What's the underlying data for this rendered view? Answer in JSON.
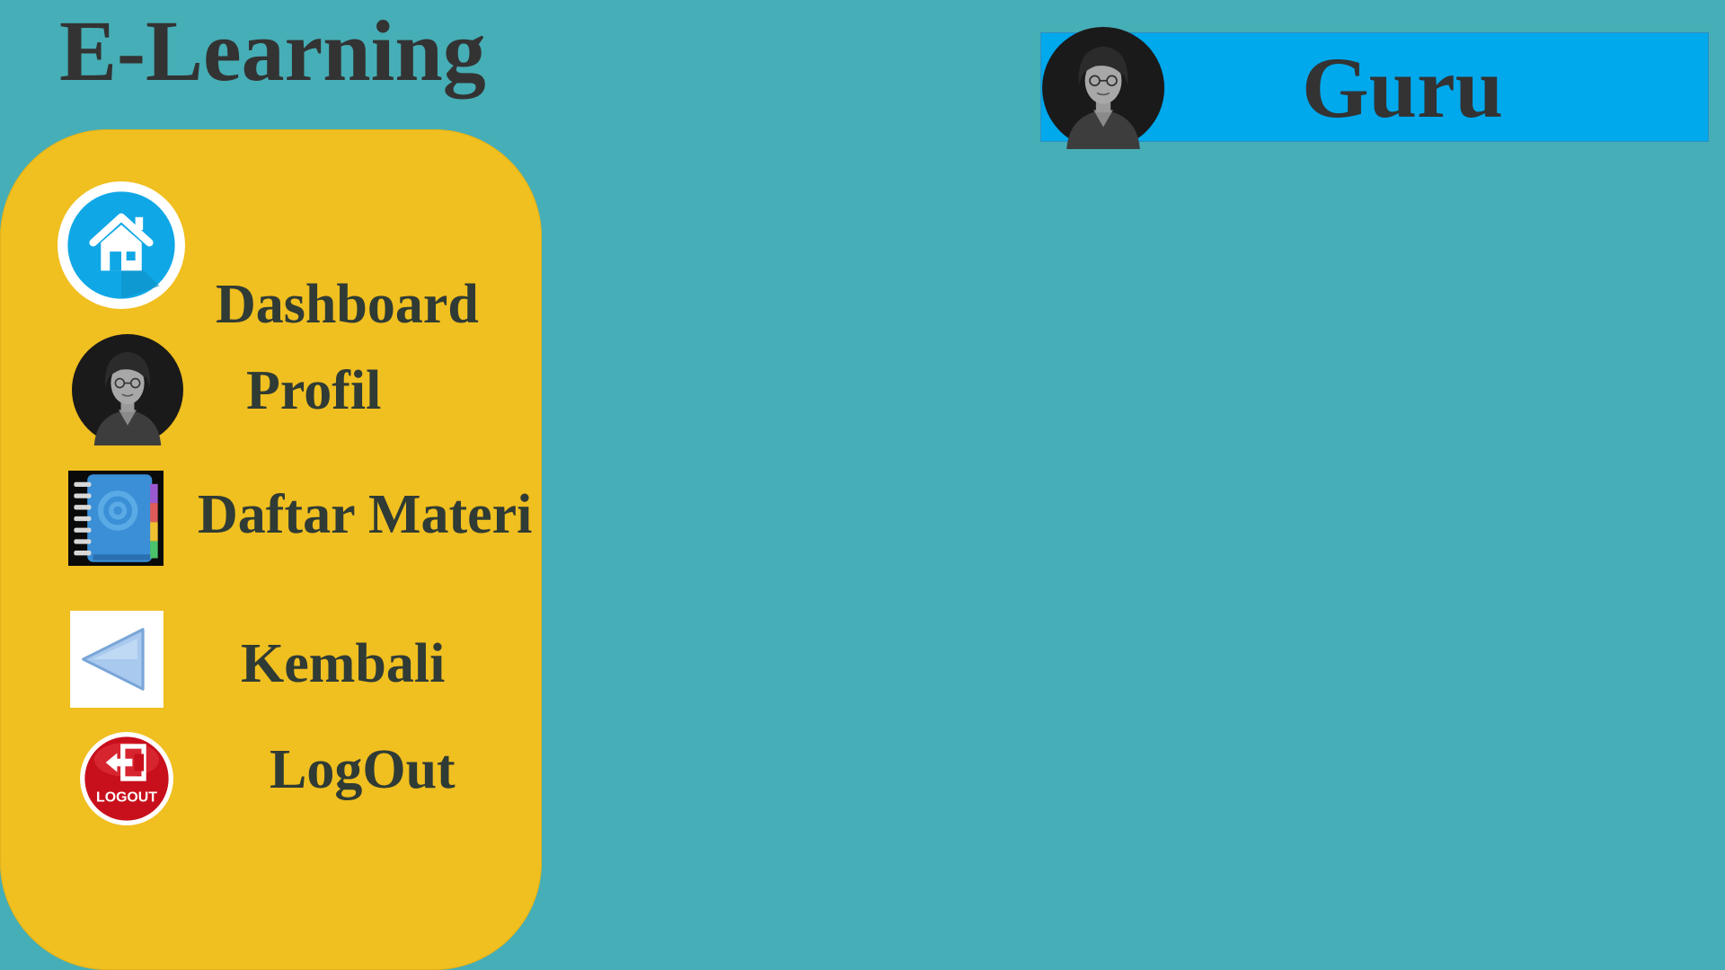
{
  "app": {
    "title": "E-Learning"
  },
  "header": {
    "user_role": "Guru"
  },
  "sidebar": {
    "items": [
      {
        "label": "Dashboard",
        "icon": "home-icon"
      },
      {
        "label": "Profil",
        "icon": "avatar-icon"
      },
      {
        "label": "Daftar Materi",
        "icon": "address-book-icon"
      },
      {
        "label": "Kembali",
        "icon": "back-arrow-icon"
      },
      {
        "label": "LogOut",
        "icon": "logout-icon",
        "icon_text": "LOGOUT"
      }
    ]
  },
  "colors": {
    "background": "#46aeb6",
    "sidebar": "#f0bf20",
    "banner": "#00a8ec",
    "text": "#333333"
  }
}
